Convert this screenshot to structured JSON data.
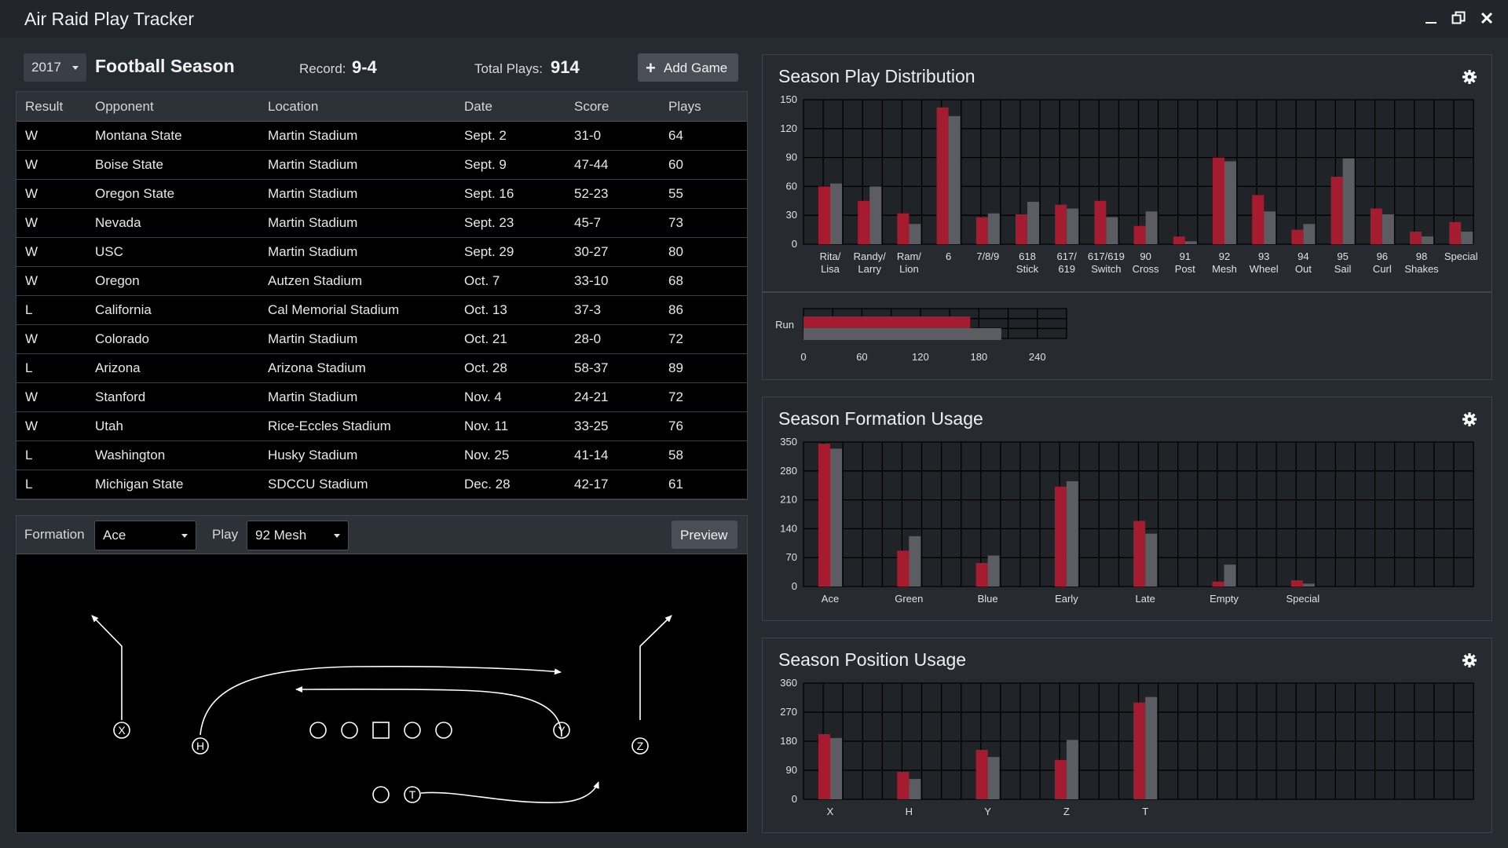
{
  "window": {
    "title": "Air Raid Play Tracker"
  },
  "season": {
    "year": "2017",
    "title": "Football Season",
    "record_label": "Record:",
    "record": "9-4",
    "total_plays_label": "Total Plays:",
    "total_plays": "914",
    "add_game_label": "Add Game"
  },
  "games": {
    "headers": [
      "Result",
      "Opponent",
      "Location",
      "Date",
      "Score",
      "Plays"
    ],
    "rows": [
      [
        "W",
        "Montana State",
        "Martin Stadium",
        "Sept. 2",
        "31-0",
        "64"
      ],
      [
        "W",
        "Boise State",
        "Martin Stadium",
        "Sept. 9",
        "47-44",
        "60"
      ],
      [
        "W",
        "Oregon State",
        "Martin Stadium",
        "Sept. 16",
        "52-23",
        "55"
      ],
      [
        "W",
        "Nevada",
        "Martin Stadium",
        "Sept. 23",
        "45-7",
        "73"
      ],
      [
        "W",
        "USC",
        "Martin Stadium",
        "Sept. 29",
        "30-27",
        "80"
      ],
      [
        "W",
        "Oregon",
        "Autzen Stadium",
        "Oct. 7",
        "33-10",
        "68"
      ],
      [
        "L",
        "California",
        "Cal Memorial Stadium",
        "Oct. 13",
        "37-3",
        "86"
      ],
      [
        "W",
        "Colorado",
        "Martin Stadium",
        "Oct. 21",
        "28-0",
        "72"
      ],
      [
        "L",
        "Arizona",
        "Arizona Stadium",
        "Oct. 28",
        "58-37",
        "89"
      ],
      [
        "W",
        "Stanford",
        "Martin Stadium",
        "Nov. 4",
        "24-21",
        "72"
      ],
      [
        "W",
        "Utah",
        "Rice-Eccles Stadium",
        "Nov. 11",
        "33-25",
        "76"
      ],
      [
        "L",
        "Washington",
        "Husky Stadium",
        "Nov. 25",
        "41-14",
        "58"
      ],
      [
        "L",
        "Michigan State",
        "SDCCU Stadium",
        "Dec. 28",
        "42-17",
        "61"
      ]
    ]
  },
  "play_viewer": {
    "formation_label": "Formation",
    "formation_value": "Ace",
    "play_label": "Play",
    "play_value": "92 Mesh",
    "preview_label": "Preview",
    "players": [
      "X",
      "H",
      "Y",
      "Z",
      "T"
    ]
  },
  "colors": {
    "primary_series": "#a51c30",
    "secondary_series": "#5b5d62",
    "background": "#262a31"
  },
  "icons": [
    "minimize-icon",
    "restore-icon",
    "close-icon",
    "plus-icon",
    "gear-icon",
    "caret-down-icon"
  ],
  "chart_data": [
    {
      "type": "bar",
      "title": "Season Play Distribution",
      "categories": [
        "Rita/\nLisa",
        "Randy/\nLarry",
        "Ram/\nLion",
        "6",
        "7/8/9",
        "618\nStick",
        "617/\n619",
        "617/619\nSwitch",
        "90\nCross",
        "91\nPost",
        "92\nMesh",
        "93\nWheel",
        "94\nOut",
        "95\nSail",
        "96\nCurl",
        "98\nShakes",
        "Special"
      ],
      "series": [
        {
          "values": [
            60,
            45,
            32,
            142,
            28,
            31,
            41,
            45,
            19,
            8,
            90,
            51,
            15,
            70,
            37,
            13,
            23
          ]
        },
        {
          "values": [
            63,
            60,
            21,
            133,
            32,
            44,
            37,
            28,
            34,
            3,
            86,
            34,
            21,
            89,
            31,
            8,
            13
          ]
        }
      ],
      "yticks": [
        0,
        30,
        60,
        90,
        120,
        150
      ],
      "ylim": [
        0,
        150
      ],
      "grid": true
    },
    {
      "type": "bar",
      "orientation": "horizontal",
      "categories": [
        "Run"
      ],
      "series": [
        {
          "values": [
            171
          ]
        },
        {
          "values": [
            203
          ]
        }
      ],
      "xticks": [
        0,
        60,
        120,
        180,
        240
      ],
      "xlim": [
        0,
        270
      ],
      "grid": true
    },
    {
      "type": "bar",
      "title": "Season Formation Usage",
      "categories": [
        "Ace",
        "Green",
        "Blue",
        "Early",
        "Late",
        "Empty",
        "Special"
      ],
      "series": [
        {
          "values": [
            346,
            87,
            57,
            242,
            159,
            12,
            15
          ]
        },
        {
          "values": [
            334,
            122,
            75,
            255,
            128,
            53,
            7
          ]
        }
      ],
      "yticks": [
        0,
        70,
        140,
        210,
        280,
        350
      ],
      "ylim": [
        0,
        350
      ],
      "grid": true
    },
    {
      "type": "bar",
      "title": "Season Position Usage",
      "categories": [
        "X",
        "H",
        "Y",
        "Z",
        "T"
      ],
      "series": [
        {
          "values": [
            202,
            85,
            153,
            122,
            300
          ]
        },
        {
          "values": [
            190,
            63,
            131,
            184,
            317
          ]
        }
      ],
      "yticks": [
        0,
        90,
        180,
        270,
        360
      ],
      "ylim": [
        0,
        360
      ],
      "grid": true
    }
  ]
}
